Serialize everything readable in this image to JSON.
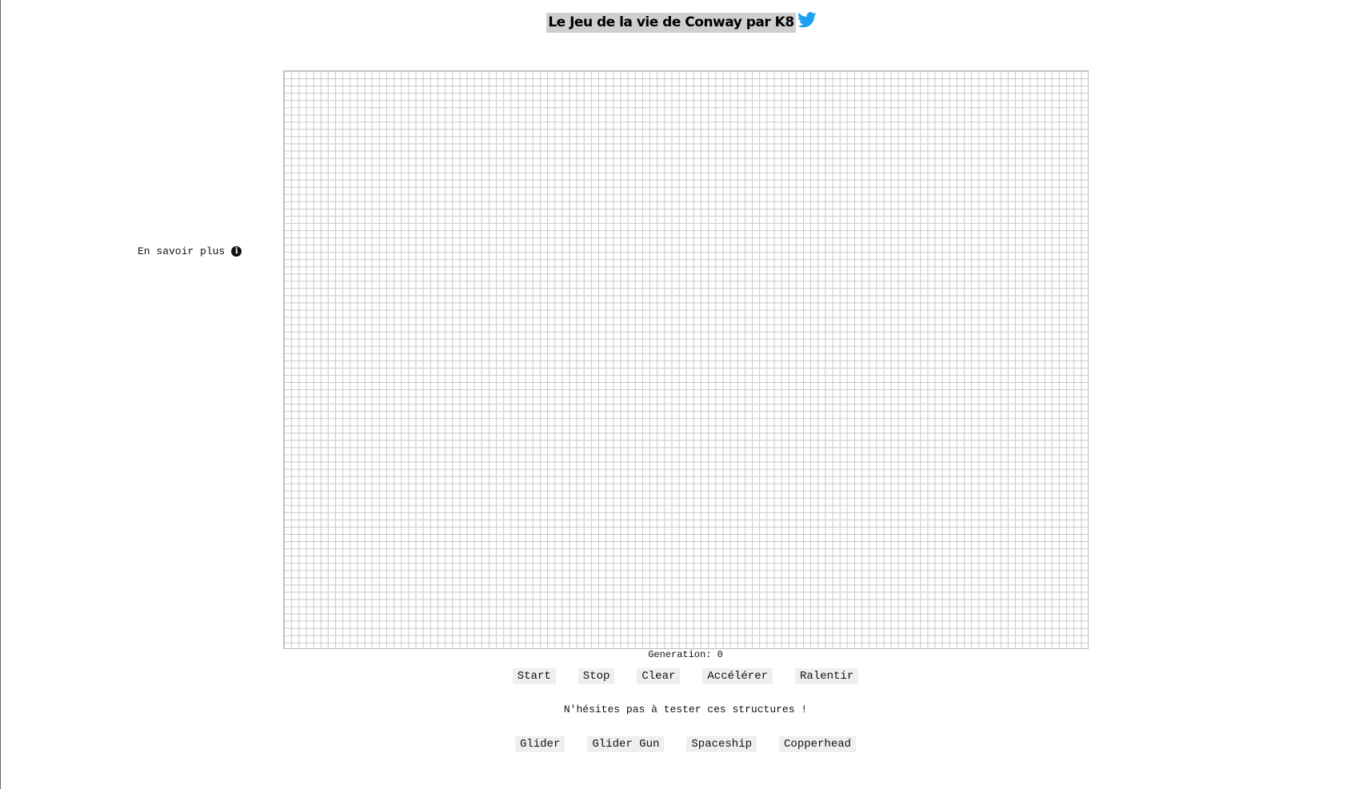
{
  "header": {
    "title": "Le Jeu de la vie de Conway par K8",
    "twitter_color": "#1DA1F2"
  },
  "sidebar": {
    "info_label": "En savoir plus",
    "info_icon": "info-icon"
  },
  "board": {
    "generation_label": "Generation: 0"
  },
  "controls": {
    "start": "Start",
    "stop": "Stop",
    "clear": "Clear",
    "accelerate": "Accélérer",
    "slow": "Ralentir"
  },
  "patterns": {
    "prompt": "N'hésites pas à tester ces structures !",
    "glider": "Glider",
    "glider_gun": "Glider Gun",
    "spaceship": "Spaceship",
    "copperhead": "Copperhead"
  }
}
